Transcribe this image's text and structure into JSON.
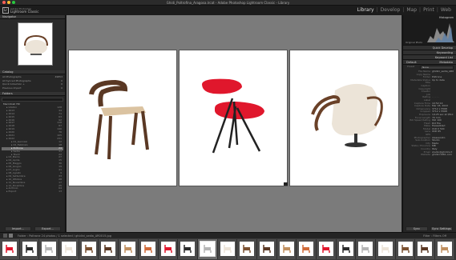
{
  "window": {
    "title": "Ghidi_Poltrofina_Aragosa.lrcat - Adobe Photoshop Lightroom Classic - Library"
  },
  "app": {
    "small": "Adobe Photoshop",
    "name": "Lightroom Classic",
    "logo": "Lr"
  },
  "modules": {
    "items": [
      "Library",
      "Develop",
      "Map",
      "Print",
      "Web"
    ],
    "active": "Library"
  },
  "left_panel": {
    "navigator": "Navigator",
    "catalog": {
      "title": "Catalog",
      "rows": [
        {
          "label": "All Photographs",
          "count": "49853"
        },
        {
          "label": "All Synced Photographs",
          "count": "0"
        },
        {
          "label": "Quick Collection +",
          "count": "0"
        },
        {
          "label": "Previous Import",
          "count": "0"
        }
      ]
    },
    "folders": {
      "title": "Folders",
      "volume": "Macintosh HD",
      "rows": [
        {
          "label": "Ghidini",
          "count": "128"
        },
        {
          "label": "2013",
          "count": "44"
        },
        {
          "label": "2014",
          "count": "71"
        },
        {
          "label": "2015",
          "count": "63"
        },
        {
          "label": "2016",
          "count": "92"
        },
        {
          "label": "2017",
          "count": "118"
        },
        {
          "label": "2018",
          "count": "87"
        },
        {
          "label": "2019",
          "count": "140"
        },
        {
          "label": "2020",
          "count": "76"
        },
        {
          "label": "2021",
          "count": "105"
        },
        {
          "label": "2022",
          "count": "231"
        },
        {
          "label": "01_Gennaio",
          "count": "12"
        },
        {
          "label": "02_Febbraio",
          "count": "18"
        },
        {
          "label": "Poltrone",
          "count": "24"
        },
        {
          "label": "Sedie",
          "count": "31"
        },
        {
          "label": "Tavoli",
          "count": "22"
        },
        {
          "label": "03_Marzo",
          "count": "27"
        },
        {
          "label": "04_Aprile",
          "count": "15"
        },
        {
          "label": "05_Maggio",
          "count": "36"
        },
        {
          "label": "06_Giugno",
          "count": "19"
        },
        {
          "label": "07_Luglio",
          "count": "41"
        },
        {
          "label": "08_Agosto",
          "count": "9"
        },
        {
          "label": "09_Settembre",
          "count": "33"
        },
        {
          "label": "10_Ottobre",
          "count": "28"
        },
        {
          "label": "11_Novembre",
          "count": "17"
        },
        {
          "label": "12_Dicembre",
          "count": "25"
        },
        {
          "label": "Archivio",
          "count": "64"
        },
        {
          "label": "Export",
          "count": "13"
        }
      ],
      "selected_index": 13
    },
    "import_btn": "Import...",
    "export_btn": "Export..."
  },
  "right_panel": {
    "histogram": "Histogram",
    "original_photo": "Original Photo",
    "quick_develop": "Quick Develop",
    "keywording": "Keywording",
    "keyword_list": "Keyword List",
    "metadata": "Metadata",
    "preset_label": "Preset",
    "preset_value": "None",
    "default_label": "Default",
    "rows": [
      {
        "k": "File Name",
        "v": "ghidini_sedia_AR0015.jpg"
      },
      {
        "k": "Copy Name",
        "v": ""
      },
      {
        "k": "Folder",
        "v": "Poltrone"
      },
      {
        "k": "Metadata Status",
        "v": "Up to date"
      },
      {
        "k": "Title",
        "v": ""
      },
      {
        "k": "Caption",
        "v": ""
      },
      {
        "k": "Copyright",
        "v": ""
      },
      {
        "k": "Creator",
        "v": ""
      },
      {
        "k": "Job",
        "v": ""
      },
      {
        "k": "Rating",
        "v": "· · · · ·"
      },
      {
        "k": "Label",
        "v": ""
      },
      {
        "k": "Capture Time",
        "v": "10:52:14"
      },
      {
        "k": "Capture Date",
        "v": "Mar 18, 2022"
      },
      {
        "k": "Dimensions",
        "v": "3712 x 5568"
      },
      {
        "k": "Cropped",
        "v": "3712 x 5568"
      },
      {
        "k": "Exposure",
        "v": "1/125 sec at f/8.0"
      },
      {
        "k": "Focal Length",
        "v": "70 mm"
      },
      {
        "k": "ISO Speed Rating",
        "v": "ISO 100"
      },
      {
        "k": "Flash",
        "v": "Did fire"
      },
      {
        "k": "Make",
        "v": "Hasselblad"
      },
      {
        "k": "Model",
        "v": "X1D II 50C"
      },
      {
        "k": "Lens",
        "v": "XCD 65"
      },
      {
        "k": "GPS",
        "v": ""
      },
      {
        "k": "Photographer",
        "v": "Alessandro"
      },
      {
        "k": "Sub-location",
        "v": "Studio"
      },
      {
        "k": "City",
        "v": "Meda"
      },
      {
        "k": "State / Province",
        "v": "MB"
      },
      {
        "k": "Country",
        "v": "Italy"
      },
      {
        "k": "Email",
        "v": "studio@ghidini.it"
      },
      {
        "k": "Website",
        "v": "ghidini1961.com"
      }
    ],
    "sync_btn": "Sync",
    "sync_settings_btn": "Sync Settings"
  },
  "filmstrip_bar": {
    "info": "Folder : Poltrone   24 photos / 1 selected / ghidini_sedia_AR0015.jpg",
    "filter_label": "Filter :",
    "filter_value": "Filters Off"
  },
  "colors": {
    "accent": "#dcdcdc",
    "chair_red": "#e0172c",
    "walnut": "#5a3824",
    "cream": "#ece4d8"
  },
  "filmstrip_count": 23
}
